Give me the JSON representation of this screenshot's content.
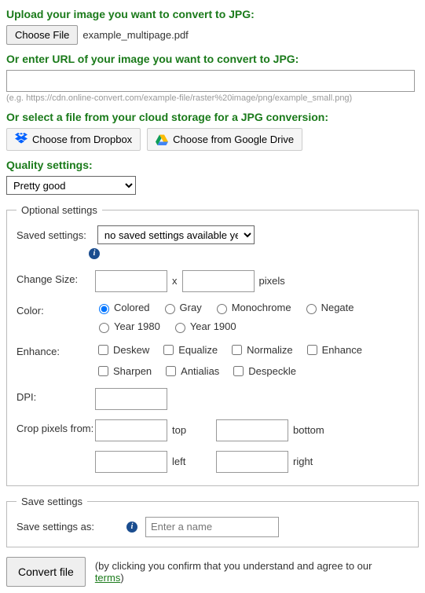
{
  "upload": {
    "heading": "Upload your image you want to convert to JPG:",
    "choose_btn": "Choose File",
    "filename": "example_multipage.pdf"
  },
  "url": {
    "heading": "Or enter URL of your image you want to convert to JPG:",
    "value": "",
    "hint": "(e.g. https://cdn.online-convert.com/example-file/raster%20image/png/example_small.png)"
  },
  "cloud": {
    "heading": "Or select a file from your cloud storage for a JPG conversion:",
    "dropbox": "Choose from Dropbox",
    "gdrive": "Choose from Google Drive"
  },
  "quality": {
    "heading": "Quality settings:",
    "selected": "Pretty good"
  },
  "optional": {
    "legend": "Optional settings",
    "saved_label": "Saved settings:",
    "saved_selected": "no saved settings available yet",
    "size_label": "Change Size:",
    "size_x": "x",
    "size_unit": "pixels",
    "color_label": "Color:",
    "color_options": [
      "Colored",
      "Gray",
      "Monochrome",
      "Negate",
      "Year 1980",
      "Year 1900"
    ],
    "enhance_label": "Enhance:",
    "enhance_options": [
      "Deskew",
      "Equalize",
      "Normalize",
      "Enhance",
      "Sharpen",
      "Antialias",
      "Despeckle"
    ],
    "dpi_label": "DPI:",
    "crop_label": "Crop pixels from:",
    "crop_top": "top",
    "crop_bottom": "bottom",
    "crop_left": "left",
    "crop_right": "right"
  },
  "save": {
    "legend": "Save settings",
    "label": "Save settings as:",
    "placeholder": "Enter a name"
  },
  "convert": {
    "btn": "Convert file",
    "disclaimer_prefix": "(by clicking you confirm that you understand and agree to our ",
    "terms": "terms",
    "disclaimer_suffix": ")"
  }
}
